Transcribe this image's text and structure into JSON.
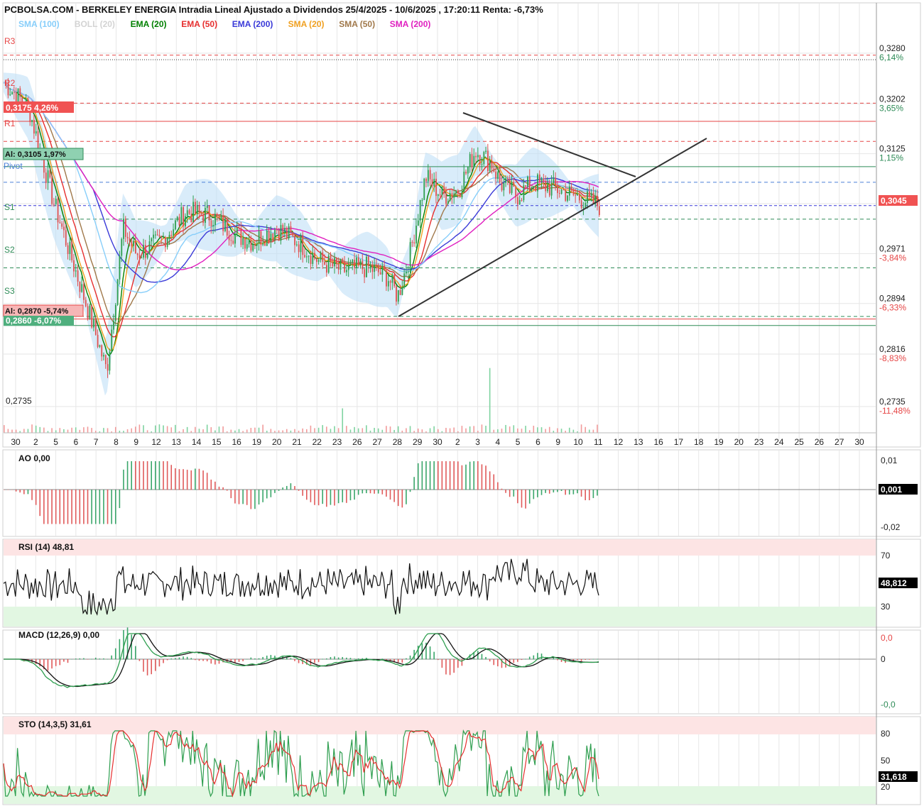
{
  "header": {
    "title": "PCBOLSA.COM - BERKELEY ENERGIA Intradia Lineal Ajustado a Dividendos 25/4/2025 - 10/6/2025 , 17:20:11 Renta: -6,73%"
  },
  "legend": [
    {
      "text": "SMA (100)",
      "color": "#87cefa"
    },
    {
      "text": "BOLL (20)",
      "color": "#d3d3d3"
    },
    {
      "text": "EMA (20)",
      "color": "#008000"
    },
    {
      "text": "EMA (50)",
      "color": "#e62e2e"
    },
    {
      "text": "EMA (200)",
      "color": "#3a3ad8"
    },
    {
      "text": "SMA (20)",
      "color": "#f0a020"
    },
    {
      "text": "SMA (50)",
      "color": "#a0784a"
    },
    {
      "text": "SMA (200)",
      "color": "#e020c0"
    }
  ],
  "levels": {
    "r3": "R3",
    "r2": "R2",
    "r1": "R1",
    "pivot": "Pivot",
    "s1": "S1",
    "s2": "S2",
    "s3": "S3",
    "max_tag": "0,3175  4,26%",
    "alert_high": "Al: 0,3105  1,97%",
    "alert_low": "Al: 0,2870  -5,74%",
    "min_tag": "0,2860  -6,07%",
    "low_label": "0,2735"
  },
  "right_axis": {
    "prices": [
      {
        "value": 0.328,
        "label": "0,3280",
        "pct": "6,14%",
        "pct_color": "#2e8b57"
      },
      {
        "value": 0.3202,
        "label": "0,3202",
        "pct": "3,65%",
        "pct_color": "#2e8b57"
      },
      {
        "value": 0.3125,
        "label": "0,3125",
        "pct": "1,15%",
        "pct_color": "#2e8b57"
      },
      {
        "value": 0.3048,
        "label": "0,3048",
        "pct": "",
        "pct_color": "#2e8b57"
      },
      {
        "value": 0.2971,
        "label": "0,2971",
        "pct": "-3,84%",
        "pct_color": "#e64646"
      },
      {
        "value": 0.2894,
        "label": "0,2894",
        "pct": "-6,33%",
        "pct_color": "#e64646"
      },
      {
        "value": 0.2816,
        "label": "0,2816",
        "pct": "-8,83%",
        "pct_color": "#e64646"
      },
      {
        "value": 0.2735,
        "label": "0,2735",
        "pct": "-11,48%",
        "pct_color": "#e64646"
      }
    ],
    "current_price": "0,3045"
  },
  "x_axis": {
    "dates": [
      "30",
      "2",
      "5",
      "6",
      "7",
      "8",
      "9",
      "12",
      "13",
      "14",
      "15",
      "16",
      "19",
      "20",
      "21",
      "22",
      "23",
      "26",
      "27",
      "28",
      "29",
      "30",
      "2",
      "3",
      "4",
      "5",
      "6",
      "9",
      "10",
      "11",
      "12",
      "13",
      "16",
      "17",
      "18",
      "19",
      "20",
      "23",
      "24",
      "25",
      "26",
      "27",
      "30"
    ]
  },
  "indicators": {
    "ao": {
      "label": "AO   0,00",
      "top": "0,01",
      "bottom": "-0,02",
      "value": "0,001"
    },
    "rsi": {
      "label": "RSI (14)   48,81",
      "upper": "70",
      "lower": "30",
      "value": "48,812"
    },
    "macd": {
      "label": "MACD (12,26,9)   0,00",
      "top": "0,0",
      "mid": "0",
      "bottom": "-0,0"
    },
    "sto": {
      "label": "STO (14,3,5)   31,61",
      "upper": "80",
      "mid": "50",
      "lower": "20",
      "value": "31,618"
    }
  },
  "chart_data": {
    "type": "candlestick",
    "title": "PCBOLSA.COM - BERKELEY ENERGIA Intradia Lineal Ajustado a Dividendos 25/4/2025 - 10/6/2025 , 17:20:11 Renta: -6,73%",
    "ylim": [
      0.2735,
      0.328
    ],
    "current_price": 0.3045,
    "support_resistance": {
      "R3": 0.3277,
      "R2": 0.3203,
      "R1": 0.3144,
      "Pivot": 0.3081,
      "S1": 0.3024,
      "S2": 0.2949,
      "S3": 0.2874
    },
    "maximum": 0.3175,
    "minimum": 0.286,
    "alerts": [
      0.3105,
      0.287
    ],
    "indicator_values": {
      "AO": 0.001,
      "RSI": 48.812,
      "STO": 31.618,
      "MACD": 0.0
    }
  },
  "colors": {
    "up": "#2e9e4f",
    "down": "#e0504f",
    "grid": "#e6e6e6",
    "resistance": "#e64646",
    "support": "#2e8b57",
    "pivot": "#4a7fd8",
    "current": "#f05252",
    "boll": "#bfe0f7"
  }
}
